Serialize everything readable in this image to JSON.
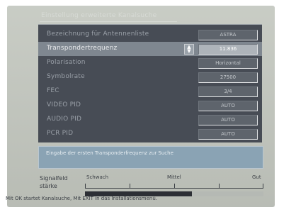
{
  "screen": {
    "title": "Einstellung erweiterte Kanalsuche"
  },
  "rows": [
    {
      "label": "Bezeichnung für Antennenliste",
      "value": "ASTRA"
    },
    {
      "label": "Transpondertrequenz",
      "value": "11.836",
      "selected": true
    },
    {
      "label": "Polarisation",
      "value": "Horizontal"
    },
    {
      "label": "Symbolrate",
      "value": "27500"
    },
    {
      "label": "FEC",
      "value": "3/4"
    },
    {
      "label": "VIDEO PID",
      "value": "AUTO"
    },
    {
      "label": "AUDIO PID",
      "value": "AUTO"
    },
    {
      "label": "PCR PID",
      "value": "AUTO"
    }
  ],
  "help_text": "Eingabe der ersten Transponderfrequenz zur Suche",
  "signal": {
    "label_line1": "Signalfeld",
    "label_line2": "stärke",
    "marker_weak": "Schwach",
    "marker_mid": "Mittel",
    "marker_good": "Gut",
    "level": 0.6
  },
  "footer": "Mit OK startet Kanalsuche, Mit EXIT in das Installationsmenü.",
  "colors": {
    "panel": "#474c55",
    "selected_row": "#7f8790",
    "help_box": "#8aa3b4",
    "signal_fill": "#2c2f35"
  }
}
